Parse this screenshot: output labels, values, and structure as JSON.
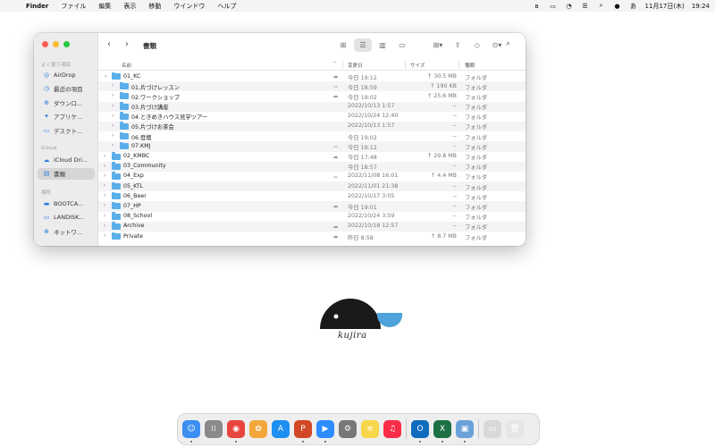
{
  "menubar": {
    "app": "Finder",
    "items": [
      "ファイル",
      "編集",
      "表示",
      "移動",
      "ウインドウ",
      "ヘルプ"
    ],
    "status": {
      "input": "あ",
      "date": "11月17日(木)",
      "time": "19:24"
    }
  },
  "sidebar": {
    "favorites_label": "よく使う項目",
    "favorites": [
      {
        "label": "AirDrop",
        "icon": "airdrop-icon",
        "glyph": "◎"
      },
      {
        "label": "最近の項目",
        "icon": "clock-icon",
        "glyph": "◷"
      },
      {
        "label": "ダウンロ...",
        "icon": "download-icon",
        "glyph": "⊕"
      },
      {
        "label": "アプリケ...",
        "icon": "applications-icon",
        "glyph": "✦"
      },
      {
        "label": "デスクト...",
        "icon": "desktop-icon",
        "glyph": "▭"
      }
    ],
    "icloud_label": "iCloud",
    "icloud": [
      {
        "label": "iCloud Dri...",
        "icon": "cloud-icon",
        "glyph": "☁"
      },
      {
        "label": "書類",
        "icon": "document-icon",
        "glyph": "▤"
      }
    ],
    "locations_label": "場所",
    "locations": [
      {
        "label": "BOOTCA...",
        "icon": "disk-icon",
        "glyph": "▬"
      },
      {
        "label": "LANDISK...",
        "icon": "server-icon",
        "glyph": "▭"
      },
      {
        "label": "ネットワ...",
        "icon": "network-icon",
        "glyph": "⊗"
      }
    ]
  },
  "window": {
    "title": "書類"
  },
  "columns": {
    "name": "名前",
    "date": "変更日",
    "size": "サイズ",
    "kind": "種類"
  },
  "files": [
    {
      "name": "01_KC",
      "level": 0,
      "expanded": true,
      "cloud": "download",
      "date": "今日 19:12",
      "size": "↑ 30.5 MB",
      "kind": "フォルダ"
    },
    {
      "name": "01.片づけレッスン",
      "level": 1,
      "expanded": false,
      "cloud": "light",
      "date": "今日 18:59",
      "size": "↑ 190 KB",
      "kind": "フォルダ"
    },
    {
      "name": "02.ワークショップ",
      "level": 1,
      "expanded": false,
      "cloud": "download",
      "date": "今日 19:02",
      "size": "↑ 25.6 MB",
      "kind": "フォルダ"
    },
    {
      "name": "03.片づけ講座",
      "level": 1,
      "expanded": false,
      "cloud": "",
      "date": "2022/10/13 1:57",
      "size": "--",
      "kind": "フォルダ"
    },
    {
      "name": "04.ときめきハウス見学ツアー",
      "level": 1,
      "expanded": false,
      "cloud": "",
      "date": "2022/10/24 12:40",
      "size": "--",
      "kind": "フォルダ"
    },
    {
      "name": "05.片づけお茶会",
      "level": 1,
      "expanded": false,
      "cloud": "",
      "date": "2022/10/13 1:57",
      "size": "--",
      "kind": "フォルダ"
    },
    {
      "name": "06.登壇",
      "level": 1,
      "expanded": false,
      "cloud": "",
      "date": "今日 19:02",
      "size": "--",
      "kind": "フォルダ"
    },
    {
      "name": "07.KMJ",
      "level": 1,
      "expanded": false,
      "cloud": "light",
      "date": "今日 19:12",
      "size": "--",
      "kind": "フォルダ"
    },
    {
      "name": "02_KMBC",
      "level": 0,
      "expanded": false,
      "cloud": "download",
      "date": "今日 17:48",
      "size": "↑ 29.8 MB",
      "kind": "フォルダ"
    },
    {
      "name": "03_Community",
      "level": 0,
      "expanded": false,
      "cloud": "",
      "date": "今日 18:57",
      "size": "--",
      "kind": "フォルダ"
    },
    {
      "name": "04_Exp",
      "level": 0,
      "expanded": false,
      "cloud": "light",
      "date": "2022/11/08 16:01",
      "size": "↑ 4.4 MB",
      "kind": "フォルダ"
    },
    {
      "name": "05_KTL",
      "level": 0,
      "expanded": false,
      "cloud": "",
      "date": "2022/11/01 21:38",
      "size": "--",
      "kind": "フォルダ"
    },
    {
      "name": "06_Beer",
      "level": 0,
      "expanded": false,
      "cloud": "",
      "date": "2022/10/17 3:05",
      "size": "--",
      "kind": "フォルダ"
    },
    {
      "name": "07_HP",
      "level": 0,
      "expanded": false,
      "cloud": "download",
      "date": "今日 19:01",
      "size": "--",
      "kind": "フォルダ"
    },
    {
      "name": "08_School",
      "level": 0,
      "expanded": false,
      "cloud": "",
      "date": "2022/10/24 3:59",
      "size": "--",
      "kind": "フォルダ"
    },
    {
      "name": "Archive",
      "level": 0,
      "expanded": false,
      "cloud": "download",
      "date": "2022/10/18 12:57",
      "size": "--",
      "kind": "フォルダ"
    },
    {
      "name": "Private",
      "level": 0,
      "expanded": false,
      "cloud": "download",
      "date": "昨日 8:58",
      "size": "↑ 8.7 MB",
      "kind": "フォルダ"
    }
  ],
  "logo": {
    "text": "kujira",
    "colors": {
      "dark": "#1a1a1a",
      "accent": "#4ea3db"
    }
  },
  "dock": {
    "apps": [
      {
        "name": "finder",
        "color": "#3b8ff0",
        "glyph": "☺",
        "running": true
      },
      {
        "name": "launchpad",
        "color": "#8a8a8a",
        "glyph": "⁞⁞",
        "running": false
      },
      {
        "name": "chrome",
        "color": "#e8453c",
        "glyph": "◉",
        "running": true
      },
      {
        "name": "photos",
        "color": "#f3a73b",
        "glyph": "✿",
        "running": false
      },
      {
        "name": "app-store",
        "color": "#1d8ff0",
        "glyph": "A",
        "running": false
      },
      {
        "name": "powerpoint",
        "color": "#d24726",
        "glyph": "P",
        "running": true
      },
      {
        "name": "zoom",
        "color": "#2d8cff",
        "glyph": "▶",
        "running": true
      },
      {
        "name": "system-preferences",
        "color": "#777777",
        "glyph": "⚙",
        "running": false
      },
      {
        "name": "notes",
        "color": "#f7d64a",
        "glyph": "≡",
        "running": false
      },
      {
        "name": "music",
        "color": "#fa2d48",
        "glyph": "♫",
        "running": false
      },
      {
        "name": "outlook",
        "color": "#0f6cbd",
        "glyph": "O",
        "running": true
      },
      {
        "name": "excel",
        "color": "#1d7044",
        "glyph": "X",
        "running": true
      },
      {
        "name": "preview",
        "color": "#6aa1d8",
        "glyph": "▣",
        "running": true
      },
      {
        "name": "screenshot-window",
        "color": "#d9d9d9",
        "glyph": "▭",
        "running": false
      },
      {
        "name": "trash",
        "color": "#e6e6e6",
        "glyph": "🗑",
        "running": false
      }
    ]
  }
}
